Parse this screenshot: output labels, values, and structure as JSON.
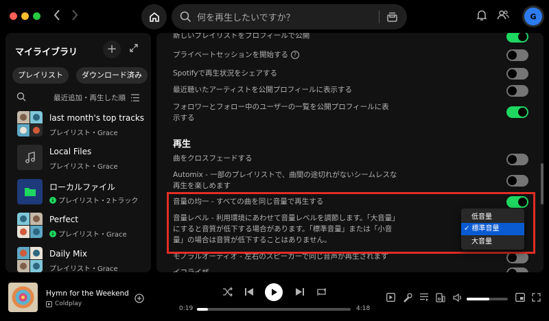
{
  "search": {
    "placeholder": "何を再生したいですか？"
  },
  "library": {
    "title": "マイライブラリ",
    "filters": [
      "プレイリスト",
      "ダウンロード済み"
    ],
    "sort_label": "最近追加・再生した順",
    "items": [
      {
        "name": "last month's top tracks",
        "subtitle": "プレイリスト・Grace",
        "downloaded": false
      },
      {
        "name": "Local Files",
        "subtitle": "プレイリスト・Grace",
        "downloaded": false
      },
      {
        "name": "ローカルファイル",
        "subtitle": "プレイリスト・2トラック",
        "downloaded": true
      },
      {
        "name": "Perfect",
        "subtitle": "プレイリスト・Grace",
        "downloaded": true
      },
      {
        "name": "Daily Mix",
        "subtitle": "プレイリスト・Grace",
        "downloaded": false
      }
    ]
  },
  "user": {
    "initial": "G"
  },
  "settings": {
    "social_rows": [
      {
        "label": "新しいプレイリストをプロフィールで公開",
        "on": true
      },
      {
        "label": "プライベートセッションを開始する",
        "on": false,
        "help": true
      },
      {
        "label": "Spotifyで再生状況をシェアする",
        "on": false
      },
      {
        "label": "最近聴いたアーティストを公開プロフィールに表示する",
        "on": false
      },
      {
        "label_line1": "フォロワーとフォロー中のユーザーの一覧を公開プロフィールに表",
        "label_line2": "示する",
        "on": true
      }
    ],
    "playback_title": "再生",
    "playback_rows": [
      {
        "label": "曲をクロスフェードする",
        "on": false
      },
      {
        "label_line1": "Automix - 一部のプレイリストで、曲間の途切れがないシームレスな",
        "label_line2": "再生を楽しめます",
        "on": false
      },
      {
        "label": "音量の均一 - すべての曲を同じ音量で再生する",
        "on": true
      },
      {
        "label_line1": "音量レベル - 利用環境にあわせて音量レベルを調節します。「大音量」",
        "label_line2": "にすると音質が低下する場合があります。「標準音量」または「小音",
        "label_line3": "量」の場合は音質が低下することはありません。"
      },
      {
        "label": "モノラルオーディオ - 左右のスピーカーで同じ音声が再生されます",
        "on": false
      },
      {
        "label": "イコライザ",
        "on": false
      }
    ],
    "volume_options": [
      "低音量",
      "標準音量",
      "大音量"
    ],
    "volume_selected": "✓ 標準音量"
  },
  "player": {
    "title": "Hymn for the Weekend",
    "artist": "Coldplay",
    "elapsed": "0:19",
    "duration": "4:18",
    "progress_pct": 7,
    "volume_pct": 55
  },
  "colors": {
    "accent": "#1ed760",
    "highlight": "#e22d24",
    "select": "#0a5ad2"
  }
}
